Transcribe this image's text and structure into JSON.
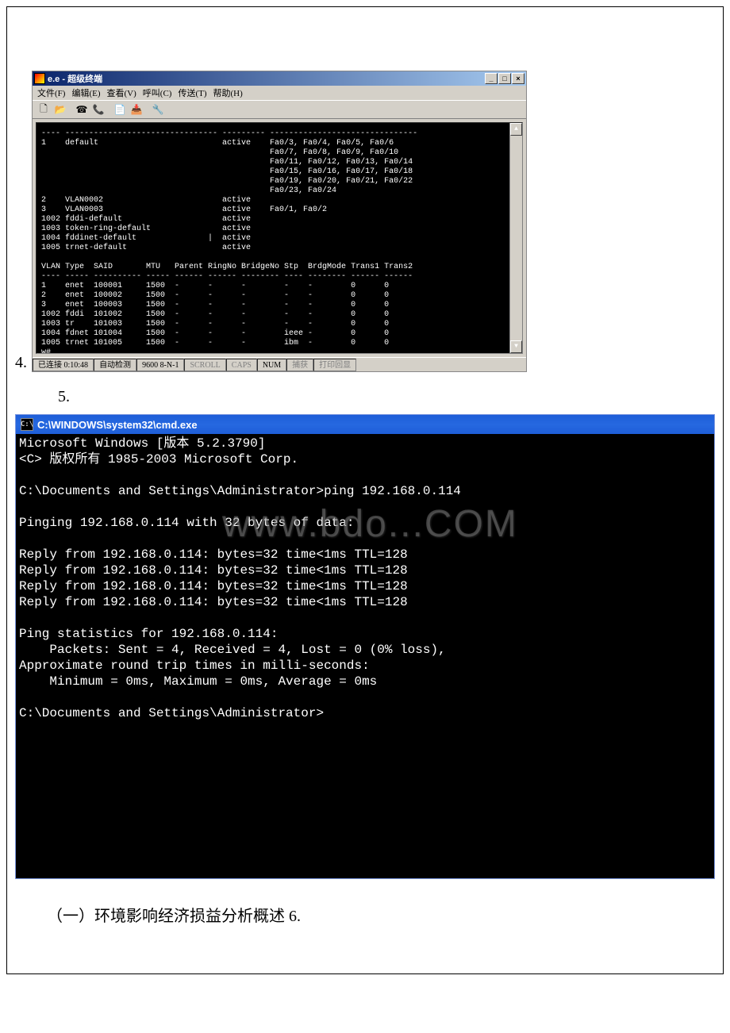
{
  "item4_number": "4.",
  "item5_number": "5.",
  "ht": {
    "title": "e.e - 超级终端",
    "menus": [
      "文件(F)",
      "编辑(E)",
      "查看(V)",
      "呼叫(C)",
      "传送(T)",
      "帮助(H)"
    ],
    "win_min": "_",
    "win_max": "□",
    "win_close": "×",
    "term_text": "---- -------------------------------- --------- -------------------------------\n1    default                          active    Fa0/3, Fa0/4, Fa0/5, Fa0/6\n                                                Fa0/7, Fa0/8, Fa0/9, Fa0/10\n                                                Fa0/11, Fa0/12, Fa0/13, Fa0/14\n                                                Fa0/15, Fa0/16, Fa0/17, Fa0/18\n                                                Fa0/19, Fa0/20, Fa0/21, Fa0/22\n                                                Fa0/23, Fa0/24\n2    VLAN0002                         active\n3    VLAN0003                         active    Fa0/1, Fa0/2\n1002 fddi-default                     active\n1003 token-ring-default               active\n1004 fddinet-default               |  active\n1005 trnet-default                    active\n\nVLAN Type  SAID       MTU   Parent RingNo BridgeNo Stp  BrdgMode Trans1 Trans2\n---- ----- ---------- ----- ------ ------ -------- ---- -------- ------ ------\n1    enet  100001     1500  -      -      -        -    -        0      0\n2    enet  100002     1500  -      -      -        -    -        0      0\n3    enet  100003     1500  -      -      -        -    -        0      0\n1002 fddi  101002     1500  -      -      -        -    -        0      0\n1003 tr    101003     1500  -      -      -        -    -        0      0\n1004 fdnet 101004     1500  -      -      -        ieee -        0      0\n1005 trnet 101005     1500  -      -      -        ibm  -        0      0\nw#_",
    "status": {
      "s1": "已连接 0:10:48",
      "s2": "自动检测",
      "s3": "9600 8-N-1",
      "s4": "SCROLL",
      "s5": "CAPS",
      "s6": "NUM",
      "s7": "捕获",
      "s8": "打印回显"
    },
    "sb_up": "▲",
    "sb_down": "▼"
  },
  "cmd": {
    "title_icon": "C:\\",
    "title": "C:\\WINDOWS\\system32\\cmd.exe",
    "body": "Microsoft Windows [版本 5.2.3790]\n<C> 版权所有 1985-2003 Microsoft Corp.\n\nC:\\Documents and Settings\\Administrator>ping 192.168.0.114\n\nPinging 192.168.0.114 with 32 bytes of data:\n\nReply from 192.168.0.114: bytes=32 time<1ms TTL=128\nReply from 192.168.0.114: bytes=32 time<1ms TTL=128\nReply from 192.168.0.114: bytes=32 time<1ms TTL=128\nReply from 192.168.0.114: bytes=32 time<1ms TTL=128\n\nPing statistics for 192.168.0.114:\n    Packets: Sent = 4, Received = 4, Lost = 0 (0% loss),\nApproximate round trip times in milli-seconds:\n    Minimum = 0ms, Maximum = 0ms, Average = 0ms\n\nC:\\Documents and Settings\\Administrator>",
    "watermark": "www.bdo...COM"
  },
  "footer": "（一）环境影响经济损益分析概述 6."
}
